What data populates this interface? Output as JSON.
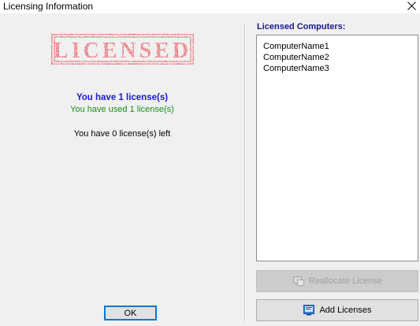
{
  "window": {
    "title": "Licensing Information",
    "close_glyph": "✕"
  },
  "left_panel": {
    "stamp_text": "LICENSED",
    "stamp_color": "#e31b23",
    "licenses_have": "You have 1 license(s)",
    "licenses_used": "You have used 1 license(s)",
    "licenses_left": "You have 0 license(s) left",
    "ok_label": "OK"
  },
  "right_panel": {
    "header": "Licensed Computers:",
    "computers": [
      "ComputerName1",
      "ComputerName2",
      "ComputerName3"
    ],
    "reallocate_label": "Reallocate License",
    "reallocate_enabled": false,
    "add_label": "Add Licenses"
  },
  "colors": {
    "have_text": "#1a1ad0",
    "used_text": "#1c8f1c",
    "header_text": "#1a1a8c",
    "ok_border": "#0078d7"
  },
  "icons": {
    "close": "close-icon",
    "reallocate": "computer-swap-icon",
    "add": "add-license-icon"
  }
}
